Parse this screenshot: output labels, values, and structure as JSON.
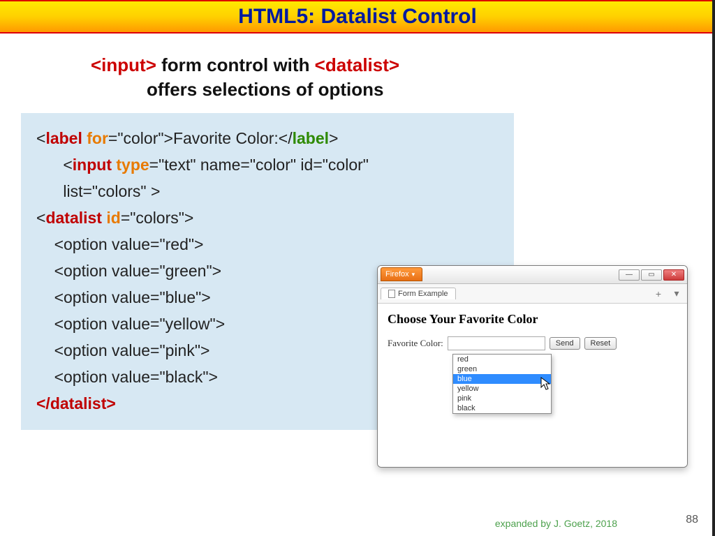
{
  "title": "HTML5: Datalist Control",
  "subtitle": {
    "input_tag": "<input>",
    "mid": " form control with ",
    "datalist_tag": "<datalist>",
    "line2": "offers selections of options"
  },
  "code": {
    "l1": {
      "a": "<",
      "b": "label",
      "c": " for",
      "d": "=\"color\">",
      "e": "Favorite Color:",
      "f": "</",
      "g": "label",
      "h": ">"
    },
    "l2": {
      "a": "<",
      "b": "input",
      "c": " type",
      "d": "=\"text\" name=\"color\" id=\"color\""
    },
    "l3": {
      "a": "list=\"colors\" >"
    },
    "l4": {
      "a": "<",
      "b": "datalist",
      "c": " id",
      "d": "=\"colors\">"
    },
    "l5": {
      "a": "<option value=\"red\">"
    },
    "l6": {
      "a": "<option value=\"green\">"
    },
    "l7": {
      "a": "<option value=\"blue\">"
    },
    "l8": {
      "a": "<option value=\"yellow\">"
    },
    "l9": {
      "a": "<option value=\"pink\">"
    },
    "l10": {
      "a": "<option value=\"black\">"
    },
    "l11": {
      "a": "</",
      "b": "datalist",
      "c": ">"
    }
  },
  "demo": {
    "firefox_label": "Firefox",
    "tab_title": "Form Example",
    "plus": "+",
    "heading": "Choose Your Favorite Color",
    "label": "Favorite Color:",
    "send": "Send",
    "reset": "Reset",
    "options": [
      "red",
      "green",
      "blue",
      "yellow",
      "pink",
      "black"
    ],
    "selected_index": 2,
    "win": {
      "min": "—",
      "max": "▭",
      "close": "✕"
    }
  },
  "footer": "expanded  by J. Goetz, 2018",
  "page_number": "88"
}
